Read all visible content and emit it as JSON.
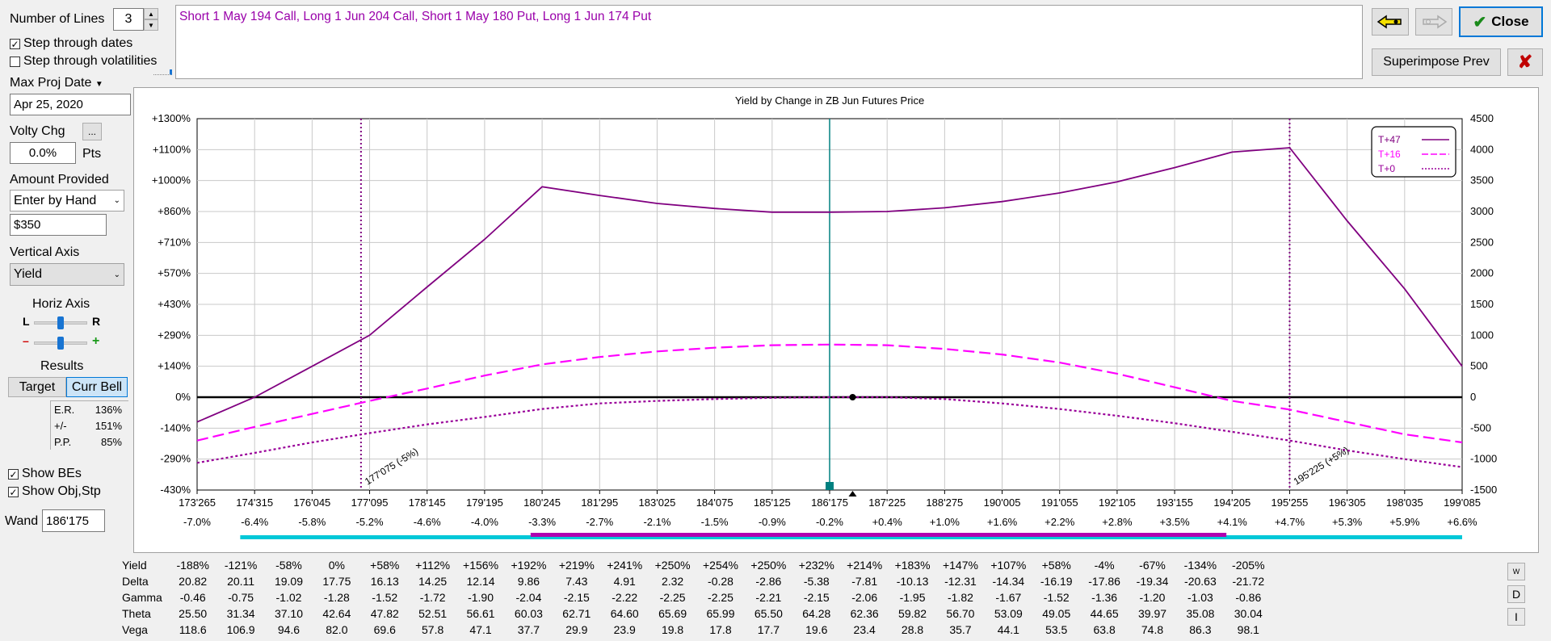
{
  "left_panel": {
    "num_lines_label": "Number of Lines",
    "num_lines_value": "3",
    "step_dates_label": "Step through dates",
    "step_dates_checked": true,
    "step_vol_label": "Step through volatilities",
    "step_vol_checked": false,
    "max_proj_label": "Max Proj Date",
    "max_proj_value": "Apr 25, 2020",
    "volty_label": "Volty Chg",
    "volty_btn": "...",
    "volty_value": "0.0%",
    "volty_unit": "Pts",
    "amount_label": "Amount Provided",
    "amount_mode": "Enter by Hand",
    "amount_value": "$350",
    "vaxis_label": "Vertical Axis",
    "vaxis_value": "Yield",
    "haxis_label": "Horiz Axis",
    "haxis_l": "L",
    "haxis_r": "R",
    "haxis_minus": "–",
    "haxis_plus": "+",
    "results_label": "Results",
    "target_btn": "Target",
    "currbell_btn": "Curr Bell",
    "results": [
      {
        "k": "E.R.",
        "v": "136%"
      },
      {
        "k": "+/-",
        "v": "151%"
      },
      {
        "k": "P.P.",
        "v": "85%"
      }
    ],
    "show_bes_label": "Show BEs",
    "show_bes_checked": true,
    "show_obj_label": "Show Obj,Stp",
    "show_obj_checked": true,
    "wand_label": "Wand",
    "wand_value": "186'175"
  },
  "strategy_text": "Short 1 May 194 Call, Long 1 Jun 204 Call, Short 1 May 180 Put, Long 1 Jun 174 Put",
  "top_right": {
    "close_label": "Close",
    "superimpose_label": "Superimpose Prev",
    "delete_icon": "x-icon",
    "back_icon": "arrow-left-icon",
    "fwd_icon": "arrow-right-icon"
  },
  "chart_data": {
    "type": "line",
    "title": "Yield by Change in ZB Jun Futures Price",
    "x_labels": [
      "173'265",
      "174'315",
      "176'045",
      "177'095",
      "178'145",
      "179'195",
      "180'245",
      "181'295",
      "183'025",
      "184'075",
      "185'125",
      "186'175",
      "187'225",
      "188'275",
      "190'005",
      "191'055",
      "192'105",
      "193'155",
      "194'205",
      "195'255",
      "196'305",
      "198'035",
      "199'085"
    ],
    "x_pct_labels": [
      "-7.0%",
      "-6.4%",
      "-5.8%",
      "-5.2%",
      "-4.6%",
      "-4.0%",
      "-3.3%",
      "-2.7%",
      "-2.1%",
      "-1.5%",
      "-0.9%",
      "-0.2%",
      "+0.4%",
      "+1.0%",
      "+1.6%",
      "+2.2%",
      "+2.8%",
      "+3.5%",
      "+4.1%",
      "+4.7%",
      "+5.3%",
      "+5.9%",
      "+6.6%"
    ],
    "y_left_labels": [
      "+1300%",
      "+1100%",
      "+1000%",
      "+860%",
      "+710%",
      "+570%",
      "+430%",
      "+290%",
      "+140%",
      "0%",
      "-140%",
      "-290%",
      "-430%"
    ],
    "y_right_labels": [
      "4500",
      "4000",
      "3500",
      "3000",
      "2500",
      "2000",
      "1500",
      "1000",
      "500",
      "0",
      "-500",
      "-1000",
      "-1500"
    ],
    "y_right_range": [
      -1500,
      4500
    ],
    "series": [
      {
        "name": "T+47",
        "color": "#800080",
        "style": "solid",
        "values": [
          -400,
          0,
          500,
          1000,
          1780,
          2550,
          3400,
          3260,
          3130,
          3050,
          2990,
          2990,
          3000,
          3060,
          3160,
          3300,
          3480,
          3710,
          3960,
          4030,
          2850,
          1750,
          500
        ]
      },
      {
        "name": "T+16",
        "color": "#ff00ff",
        "style": "dashed",
        "values": [
          -700,
          -480,
          -270,
          -60,
          140,
          350,
          530,
          650,
          740,
          800,
          840,
          850,
          840,
          780,
          690,
          560,
          380,
          160,
          -60,
          -200,
          -400,
          -600,
          -730
        ]
      },
      {
        "name": "T+0",
        "color": "#990099",
        "style": "dotted",
        "values": [
          -1060,
          -900,
          -730,
          -580,
          -440,
          -320,
          -190,
          -100,
          -60,
          -30,
          -10,
          0,
          0,
          -30,
          -100,
          -190,
          -300,
          -420,
          -560,
          -700,
          -860,
          -1000,
          -1130
        ]
      }
    ],
    "breakeven_labels": [
      "177'075 (-5%)",
      "195'225 (+5%)"
    ],
    "legend": [
      "T+47",
      "T+16",
      "T+0"
    ],
    "legend_position": "top-right",
    "grid": true
  },
  "table": {
    "rows": [
      {
        "label": "Yield",
        "values": [
          "-188%",
          "-121%",
          "-58%",
          "0%",
          "+58%",
          "+112%",
          "+156%",
          "+192%",
          "+219%",
          "+241%",
          "+250%",
          "+254%",
          "+250%",
          "+232%",
          "+214%",
          "+183%",
          "+147%",
          "+107%",
          "+58%",
          "-4%",
          "-67%",
          "-134%",
          "-205%"
        ]
      },
      {
        "label": "Delta",
        "values": [
          "20.82",
          "20.11",
          "19.09",
          "17.75",
          "16.13",
          "14.25",
          "12.14",
          "9.86",
          "7.43",
          "4.91",
          "2.32",
          "-0.28",
          "-2.86",
          "-5.38",
          "-7.81",
          "-10.13",
          "-12.31",
          "-14.34",
          "-16.19",
          "-17.86",
          "-19.34",
          "-20.63",
          "-21.72"
        ]
      },
      {
        "label": "Gamma",
        "values": [
          "-0.46",
          "-0.75",
          "-1.02",
          "-1.28",
          "-1.52",
          "-1.72",
          "-1.90",
          "-2.04",
          "-2.15",
          "-2.22",
          "-2.25",
          "-2.25",
          "-2.21",
          "-2.15",
          "-2.06",
          "-1.95",
          "-1.82",
          "-1.67",
          "-1.52",
          "-1.36",
          "-1.20",
          "-1.03",
          "-0.86"
        ]
      },
      {
        "label": "Theta",
        "values": [
          "25.50",
          "31.34",
          "37.10",
          "42.64",
          "47.82",
          "52.51",
          "56.61",
          "60.03",
          "62.71",
          "64.60",
          "65.69",
          "65.99",
          "65.50",
          "64.28",
          "62.36",
          "59.82",
          "56.70",
          "53.09",
          "49.05",
          "44.65",
          "39.97",
          "35.08",
          "30.04"
        ]
      },
      {
        "label": "Vega",
        "values": [
          "118.6",
          "106.9",
          "94.6",
          "82.0",
          "69.6",
          "57.8",
          "47.1",
          "37.7",
          "29.9",
          "23.9",
          "19.8",
          "17.8",
          "17.7",
          "19.6",
          "23.4",
          "28.8",
          "35.7",
          "44.1",
          "53.5",
          "63.8",
          "74.8",
          "86.3",
          "98.1"
        ]
      }
    ],
    "side_buttons": [
      "W",
      "D",
      "I"
    ]
  }
}
